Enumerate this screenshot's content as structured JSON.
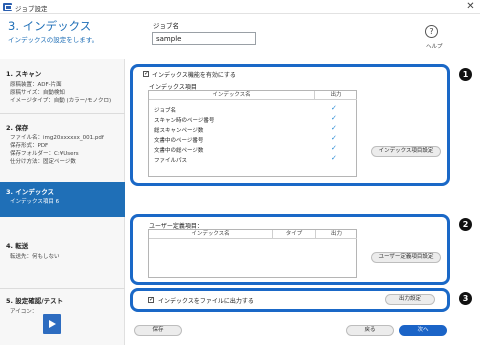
{
  "window": {
    "title": "ジョブ設定",
    "close_glyph": "✕"
  },
  "header": {
    "title": "3. インデックス",
    "subtitle": "インデックスの設定をします。",
    "job_name_label": "ジョブ名",
    "job_name_value": "sample",
    "help_label": "ヘルプ",
    "help_glyph": "?"
  },
  "sidebar": {
    "steps": [
      {
        "title": "1. スキャン",
        "lines": [
          "原稿装置：ADF-片面",
          "原稿サイズ：自動検知",
          "イメージタイプ：自動 (カラー/モノクロ)"
        ]
      },
      {
        "title": "2. 保存",
        "lines": [
          "ファイル名：img20xxxxxx_001.pdf",
          "保存形式：PDF",
          "保存フォルダー：C:¥Users",
          "仕分け方法：固定ページ数"
        ]
      },
      {
        "title": "3. インデックス",
        "lines": [
          "インデックス項目 6"
        ],
        "active": true
      },
      {
        "title": "4. 転送",
        "lines": [
          "転送先：何もしない"
        ]
      },
      {
        "title": "5. 設定確認/テスト",
        "lines": [
          "アイコン："
        ]
      }
    ],
    "preview_icon": "play-document-icon"
  },
  "index_panel": {
    "enable_label": "インデックス機能を有効にする",
    "enabled": true,
    "group_label": "インデックス項目",
    "columns": [
      "インデックス名",
      "出力"
    ],
    "rows": [
      {
        "name": "ジョブ名",
        "output": "✓"
      },
      {
        "name": "スキャン時のページ番号",
        "output": "✓"
      },
      {
        "name": "総スキャンページ数",
        "output": "✓"
      },
      {
        "name": "文書中のページ番号",
        "output": "✓"
      },
      {
        "name": "文書中の総ページ数",
        "output": "✓"
      },
      {
        "name": "ファイルパス",
        "output": "✓"
      }
    ],
    "settings_button": "インデックス項目設定"
  },
  "user_panel": {
    "group_label": "ユーザー定義項目：",
    "columns": [
      "インデックス名",
      "タイプ",
      "出力"
    ],
    "settings_button": "ユーザー定義項目設定"
  },
  "output_panel": {
    "checkbox_label": "インデックスをファイルに出力する",
    "checked": true,
    "settings_button": "出力設定"
  },
  "footer": {
    "save": "保存",
    "back": "戻る",
    "next": "次へ"
  },
  "badges": [
    "1",
    "2",
    "3"
  ],
  "colors": {
    "accent": "#1f6fb7",
    "panel_border": "#1a68c7",
    "check": "#2a8ad4"
  }
}
